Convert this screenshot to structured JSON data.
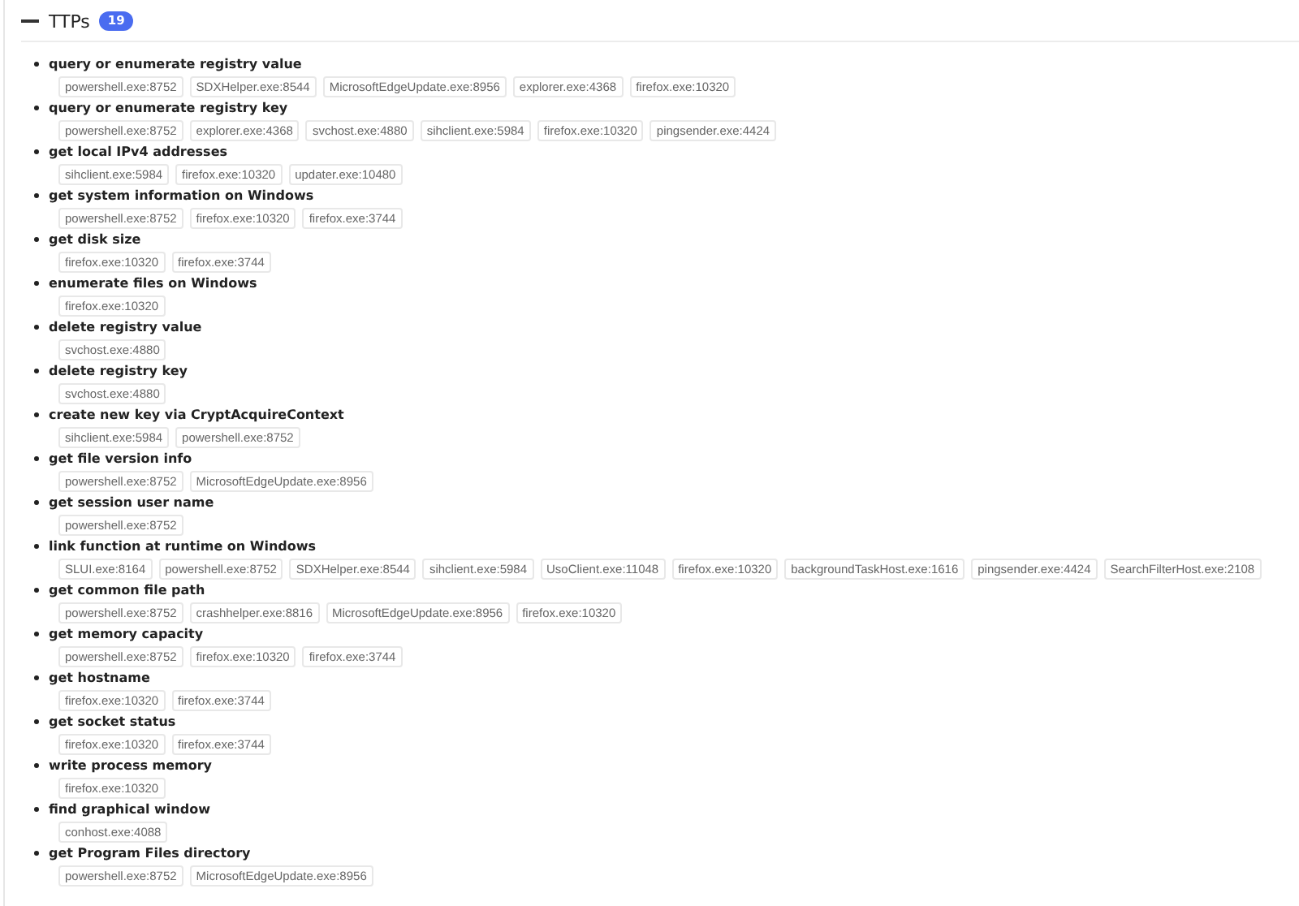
{
  "section": {
    "title": "TTPs",
    "count": "19",
    "expanded": true
  },
  "ttps": [
    {
      "name": "query or enumerate registry value",
      "processes": [
        "powershell.exe:8752",
        "SDXHelper.exe:8544",
        "MicrosoftEdgeUpdate.exe:8956",
        "explorer.exe:4368",
        "firefox.exe:10320"
      ]
    },
    {
      "name": "query or enumerate registry key",
      "processes": [
        "powershell.exe:8752",
        "explorer.exe:4368",
        "svchost.exe:4880",
        "sihclient.exe:5984",
        "firefox.exe:10320",
        "pingsender.exe:4424"
      ]
    },
    {
      "name": "get local IPv4 addresses",
      "processes": [
        "sihclient.exe:5984",
        "firefox.exe:10320",
        "updater.exe:10480"
      ]
    },
    {
      "name": "get system information on Windows",
      "processes": [
        "powershell.exe:8752",
        "firefox.exe:10320",
        "firefox.exe:3744"
      ]
    },
    {
      "name": "get disk size",
      "processes": [
        "firefox.exe:10320",
        "firefox.exe:3744"
      ]
    },
    {
      "name": "enumerate files on Windows",
      "processes": [
        "firefox.exe:10320"
      ]
    },
    {
      "name": "delete registry value",
      "processes": [
        "svchost.exe:4880"
      ]
    },
    {
      "name": "delete registry key",
      "processes": [
        "svchost.exe:4880"
      ]
    },
    {
      "name": "create new key via CryptAcquireContext",
      "processes": [
        "sihclient.exe:5984",
        "powershell.exe:8752"
      ]
    },
    {
      "name": "get file version info",
      "processes": [
        "powershell.exe:8752",
        "MicrosoftEdgeUpdate.exe:8956"
      ]
    },
    {
      "name": "get session user name",
      "processes": [
        "powershell.exe:8752"
      ]
    },
    {
      "name": "link function at runtime on Windows",
      "processes": [
        "SLUI.exe:8164",
        "powershell.exe:8752",
        "SDXHelper.exe:8544",
        "sihclient.exe:5984",
        "UsoClient.exe:11048",
        "firefox.exe:10320",
        "backgroundTaskHost.exe:1616",
        "pingsender.exe:4424",
        "SearchFilterHost.exe:2108"
      ]
    },
    {
      "name": "get common file path",
      "processes": [
        "powershell.exe:8752",
        "crashhelper.exe:8816",
        "MicrosoftEdgeUpdate.exe:8956",
        "firefox.exe:10320"
      ]
    },
    {
      "name": "get memory capacity",
      "processes": [
        "powershell.exe:8752",
        "firefox.exe:10320",
        "firefox.exe:3744"
      ]
    },
    {
      "name": "get hostname",
      "processes": [
        "firefox.exe:10320",
        "firefox.exe:3744"
      ]
    },
    {
      "name": "get socket status",
      "processes": [
        "firefox.exe:10320",
        "firefox.exe:3744"
      ]
    },
    {
      "name": "write process memory",
      "processes": [
        "firefox.exe:10320"
      ]
    },
    {
      "name": "find graphical window",
      "processes": [
        "conhost.exe:4088"
      ]
    },
    {
      "name": "get Program Files directory",
      "processes": [
        "powershell.exe:8752",
        "MicrosoftEdgeUpdate.exe:8956"
      ]
    }
  ]
}
